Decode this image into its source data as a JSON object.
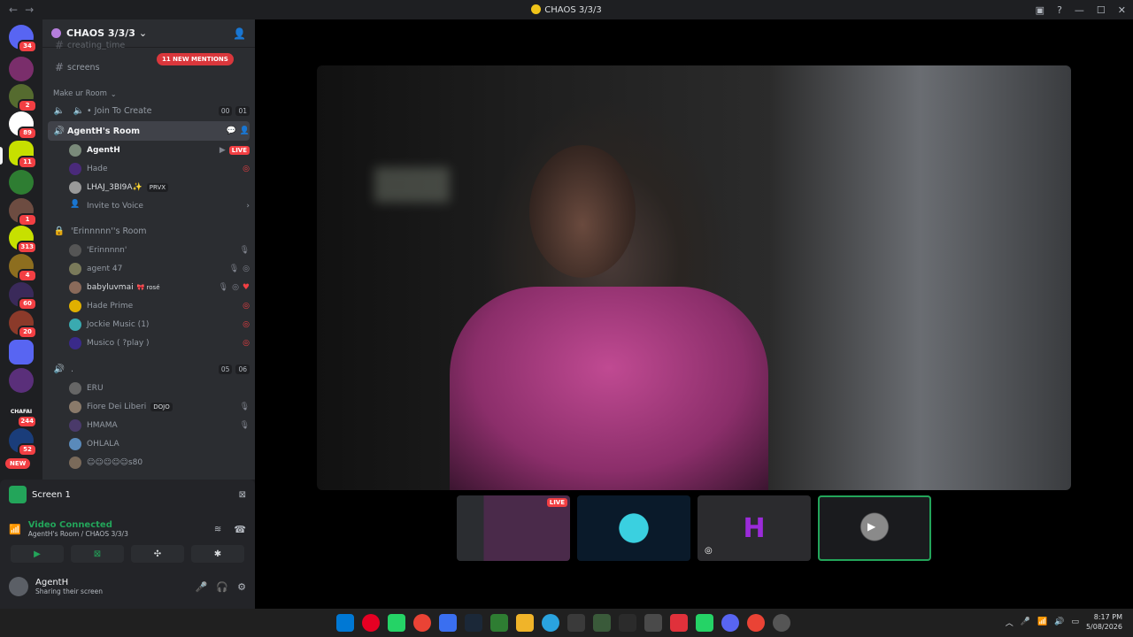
{
  "window": {
    "title": "CHAOS 3/3/3"
  },
  "server": {
    "name": "CHAOS 3/3/3"
  },
  "guild_badges": [
    "34",
    "2",
    "89",
    "11",
    "1",
    "313",
    "4",
    "60",
    "20",
    "244",
    "52"
  ],
  "guild_labels": {
    "chafai": "CHAFAI",
    "new": "NEW"
  },
  "channels": {
    "partial_top": "creating_time",
    "screens": "screens",
    "mentions_pill": "11 NEW MENTIONS",
    "category": "Make ur Room",
    "join_to_create": "• Join To Create",
    "jtc_counts": [
      "00",
      "01"
    ],
    "room_active": "AgentH's Room",
    "room_users": [
      {
        "name": "AgentH",
        "badge": "LIVE"
      },
      {
        "name": "Hade"
      },
      {
        "name": "LHAJ_3BI9A✨",
        "tag": "PRVX"
      }
    ],
    "invite": "Invite to Voice",
    "room2": "'Erinnnnn''s Room",
    "room2_users": [
      {
        "name": "'Erinnnnn'"
      },
      {
        "name": "agent 47"
      },
      {
        "name": "babyluvmai",
        "extra": "🎀 rosé"
      },
      {
        "name": "Hade Prime"
      },
      {
        "name": "Jockie Music (1)"
      },
      {
        "name": "Musico ( ?play )"
      }
    ],
    "room3": ".",
    "room3_counts": [
      "05",
      "06"
    ],
    "room3_users": [
      {
        "name": "ERU"
      },
      {
        "name": "Fiore Dei Liberi",
        "tag": "DOJO"
      },
      {
        "name": "HMAMA"
      },
      {
        "name": "OHLALA"
      },
      {
        "name": "☺☺☺☺☺s80"
      }
    ]
  },
  "voice_panel": {
    "screen_label": "Screen 1",
    "status": "Video Connected",
    "location": "AgentH's Room / CHAOS 3/3/3",
    "user_name": "AgentH",
    "user_status": "Sharing their screen"
  },
  "stage": {
    "thumb_live": "LIVE",
    "thumb_letter": "H"
  },
  "tray": {
    "time": "8:17 PM",
    "date": "5/08/2026"
  },
  "colors": {
    "accent_green": "#23a55a",
    "live_red": "#f23f43",
    "shirt_pink": "#c04a92"
  }
}
